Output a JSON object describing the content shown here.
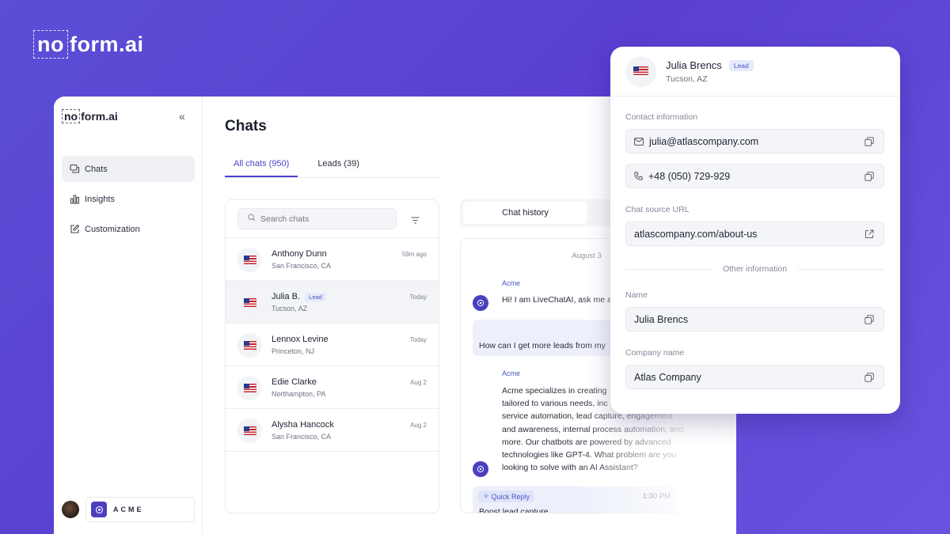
{
  "brand": {
    "no": "no",
    "rest": "form.ai"
  },
  "sidebar": {
    "logo_no": "no",
    "logo_rest": "form.ai",
    "collapse": "«",
    "items": [
      {
        "label": "Chats",
        "icon": "chat-icon",
        "active": true
      },
      {
        "label": "Insights",
        "icon": "bar-chart-icon"
      },
      {
        "label": "Customization",
        "icon": "edit-icon"
      }
    ],
    "workspace": "ACME"
  },
  "main": {
    "title": "Chats",
    "tabs": [
      {
        "label": "All chats (950)",
        "active": true
      },
      {
        "label": "Leads (39)"
      }
    ],
    "search_placeholder": "Search chats",
    "chats": [
      {
        "name": "Anthony Dunn",
        "location": "San Francisco, CA",
        "time": "59m ago",
        "lead": false
      },
      {
        "name": "Julia B.",
        "location": "Tucson, AZ",
        "time": "Today",
        "lead": true,
        "lead_label": "Lead"
      },
      {
        "name": "Lennox Levine",
        "location": "Princeton, NJ",
        "time": "Today",
        "lead": false
      },
      {
        "name": "Edie Clarke",
        "location": "Northampton, PA",
        "time": "Aug 2",
        "lead": false
      },
      {
        "name": "Alysha Hancock",
        "location": "San Francisco, CA",
        "time": "Aug 2",
        "lead": false
      }
    ]
  },
  "chat": {
    "tab": "Chat history",
    "date": "August 3",
    "messages": [
      {
        "sender": "Acme",
        "text": "Hi! I am LiveChatAI, ask me a"
      },
      {
        "user_text": "How can I get more leads from my"
      },
      {
        "sender": "Acme",
        "lines": [
          "Acme specializes in creating",
          "tailored to various needs, inc",
          "service automation, lead capture, engagement",
          "and awareness, internal process automation, and",
          "more. Our chatbots are powered by advanced",
          "technologies like GPT-4. What problem are you",
          "looking to solve with an AI Assistant?"
        ]
      }
    ],
    "quick_reply": {
      "label": "Quick Reply",
      "time": "1:30 PM",
      "text": "Boost lead capture"
    }
  },
  "card": {
    "name": "Julia Brencs",
    "badge": "Lead",
    "location": "Tucson, AZ",
    "contact_label": "Contact information",
    "email": "julia@atlascompany.com",
    "phone": "+48 (050) 729-929",
    "source_label": "Chat source URL",
    "source_url": "atlascompany.com/about-us",
    "other_label": "Other information",
    "name_label": "Name",
    "name_value": "Julia Brencs",
    "company_label": "Company name",
    "company_value": "Atlas Company"
  },
  "colors": {
    "accent": "#4a44c9",
    "background": "#5a3fd0",
    "bot": "#4b3fc0"
  }
}
